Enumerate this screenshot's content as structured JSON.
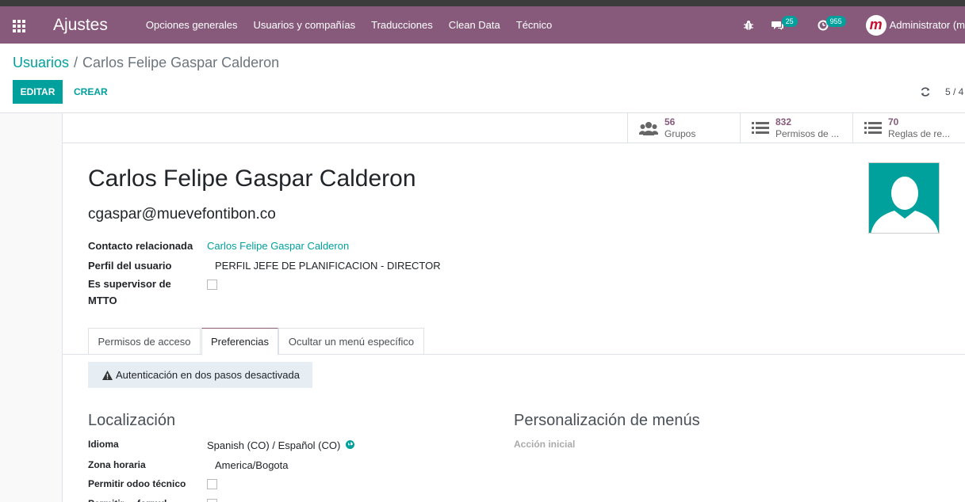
{
  "navbar": {
    "brand": "Ajustes",
    "menu": [
      "Opciones generales",
      "Usuarios y compañías",
      "Traducciones",
      "Clean Data",
      "Técnico"
    ],
    "messages_count": "25",
    "activities_count": "955",
    "user": "Administrator (m",
    "avatar_letter": "m"
  },
  "breadcrumb": {
    "parent": "Usuarios",
    "separator": "/",
    "current": "Carlos Felipe Gaspar Calderon"
  },
  "buttons": {
    "edit": "EDITAR",
    "create": "CREAR"
  },
  "pager": "5 / 4",
  "stat_buttons": [
    {
      "value": "56",
      "label": "Grupos",
      "icon": "users-icon"
    },
    {
      "value": "832",
      "label": "Permisos de ...",
      "icon": "list-icon"
    },
    {
      "value": "70",
      "label": "Reglas de re...",
      "icon": "list-icon"
    }
  ],
  "user": {
    "name": "Carlos Felipe Gaspar Calderon",
    "email": "cgaspar@muevefontibon.co"
  },
  "fields": {
    "contact_label": "Contacto relacionada",
    "contact_value": "Carlos Felipe Gaspar Calderon",
    "profile_label": "Perfil del usuario",
    "profile_value": "PERFIL JEFE DE PLANIFICACION - DIRECTOR",
    "supervisor_label_1": "Es supervisor de",
    "supervisor_label_2": "MTTO",
    "supervisor_checked": false
  },
  "tabs": [
    "Permisos de acceso",
    "Preferencias",
    "Ocultar un menú específico"
  ],
  "active_tab": "Preferencias",
  "alert": "Autenticación en dos pasos desactivada",
  "localization": {
    "title": "Localización",
    "language_label": "Idioma",
    "language_value": "Spanish (CO) / Español (CO)",
    "timezone_label": "Zona horaria",
    "timezone_value": "America/Bogota",
    "tech_label": "Permitir odoo técnico",
    "next_label": "Permitir ... formul..."
  },
  "personalization": {
    "title": "Personalización de menús",
    "action_label": "Acción inicial"
  },
  "colors": {
    "primary": "#875a7b",
    "accent": "#00a09d"
  }
}
